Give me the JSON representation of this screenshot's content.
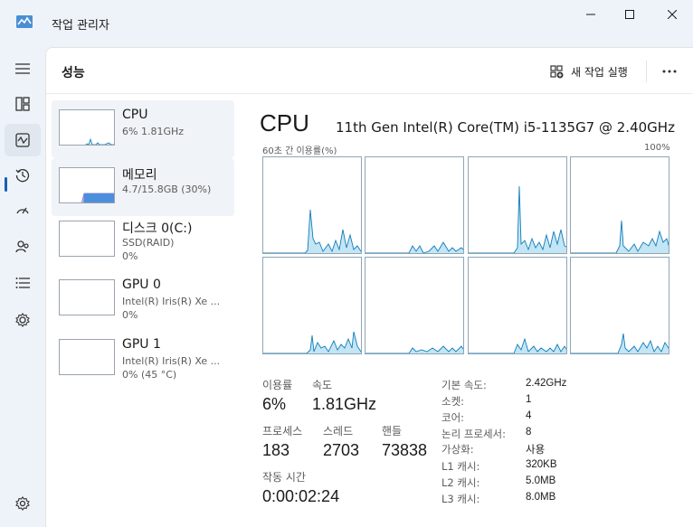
{
  "window": {
    "title": "작업 관리자",
    "accent": "#1a5fb4"
  },
  "nav": {
    "items": [
      {
        "icon": "hamburger-icon"
      },
      {
        "icon": "processes-icon"
      },
      {
        "icon": "performance-icon",
        "active": true
      },
      {
        "icon": "app-history-icon"
      },
      {
        "icon": "startup-apps-icon"
      },
      {
        "icon": "users-icon"
      },
      {
        "icon": "details-icon"
      },
      {
        "icon": "services-icon"
      },
      {
        "icon": "settings-icon"
      }
    ]
  },
  "header": {
    "page_title": "성능",
    "new_task_label": "새 작업 실행"
  },
  "perf_list": [
    {
      "name": "CPU",
      "sub1": "6% 1.81GHz",
      "selected": true
    },
    {
      "name": "메모리",
      "sub1": "4.7/15.8GB (30%)",
      "hovered": true
    },
    {
      "name": "디스크 0(C:)",
      "sub1": "SSD(RAID)",
      "sub2": "0%"
    },
    {
      "name": "GPU 0",
      "sub1": "Intel(R) Iris(R) Xe ...",
      "sub2": "0%"
    },
    {
      "name": "GPU 1",
      "sub1": "Intel(R) Iris(R) Xe ...",
      "sub2": "0% (45 °C)"
    }
  ],
  "detail": {
    "title": "CPU",
    "model": "11th Gen Intel(R) Core(TM) i5-1135G7 @ 2.40GHz",
    "graph_label_left": "60초 간 이용률(%)",
    "graph_label_right": "100%",
    "graph_color": "#117dbb",
    "graph_fill": "#c3e5f4",
    "stats": {
      "utilization_label": "이용률",
      "utilization_value": "6%",
      "speed_label": "속도",
      "speed_value": "1.81GHz",
      "processes_label": "프로세스",
      "processes_value": "183",
      "threads_label": "스레드",
      "threads_value": "2703",
      "handles_label": "핸들",
      "handles_value": "73838",
      "uptime_label": "작동 시간",
      "uptime_value": "0:00:02:24"
    },
    "specs": [
      {
        "key": "기본 속도:",
        "value": "2.42GHz"
      },
      {
        "key": "소켓:",
        "value": "1"
      },
      {
        "key": "코어:",
        "value": "4"
      },
      {
        "key": "논리 프로세서:",
        "value": "8"
      },
      {
        "key": "가상화:",
        "value": "사용"
      },
      {
        "key": "L1 캐시:",
        "value": "320KB"
      },
      {
        "key": "L2 캐시:",
        "value": "5.0MB"
      },
      {
        "key": "L3 캐시:",
        "value": "8.0MB"
      }
    ]
  }
}
